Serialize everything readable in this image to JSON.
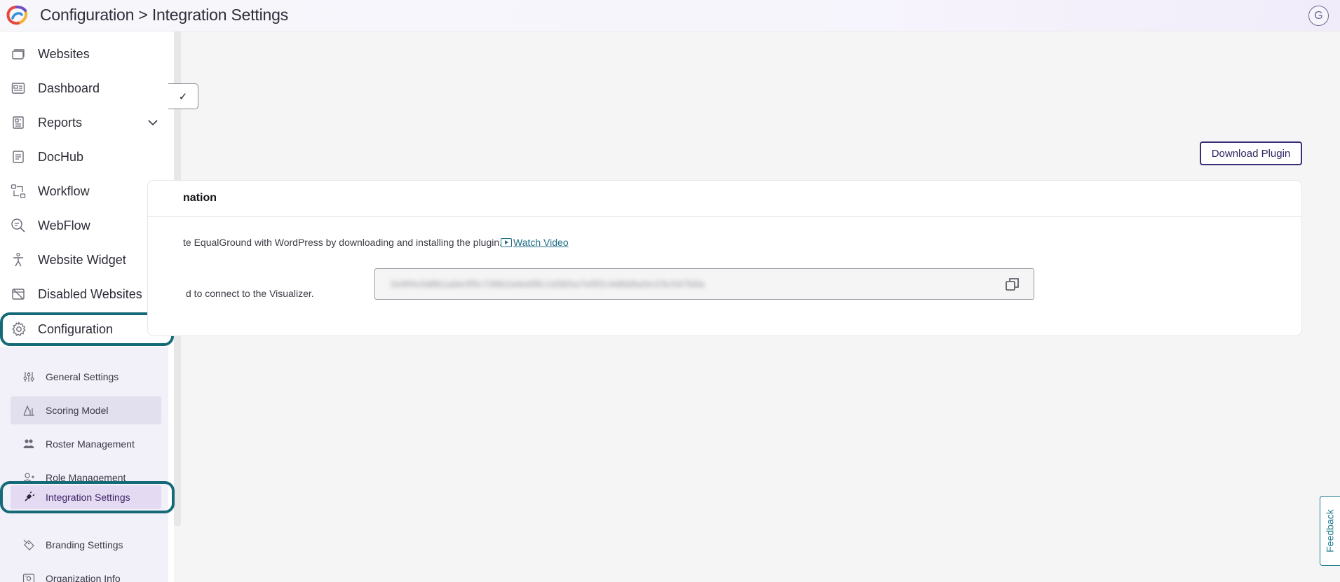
{
  "header": {
    "title": "Configuration > Integration Settings",
    "avatar_initial": "G"
  },
  "sidebar": {
    "items": [
      {
        "label": "Websites",
        "icon": "websites-icon"
      },
      {
        "label": "Dashboard",
        "icon": "dashboard-icon"
      },
      {
        "label": "Reports",
        "icon": "reports-icon"
      },
      {
        "label": "DocHub",
        "icon": "dochub-icon"
      },
      {
        "label": "Workflow",
        "icon": "workflow-icon"
      },
      {
        "label": "WebFlow",
        "icon": "webflow-icon"
      },
      {
        "label": "Website Widget",
        "icon": "widget-icon"
      },
      {
        "label": "Disabled Websites",
        "icon": "disabled-websites-icon"
      },
      {
        "label": "Configuration",
        "icon": "gear-icon"
      }
    ],
    "submenu": [
      {
        "label": "General Settings",
        "icon": "sliders-icon"
      },
      {
        "label": "Scoring Model",
        "icon": "scoring-icon"
      },
      {
        "label": "Roster Management",
        "icon": "roster-icon"
      },
      {
        "label": "Role Management",
        "icon": "role-icon"
      },
      {
        "label": "Integration Settings",
        "icon": "plug-icon"
      },
      {
        "label": "Branding Settings",
        "icon": "branding-icon"
      },
      {
        "label": "Organization Info",
        "icon": "organization-icon"
      }
    ]
  },
  "main": {
    "dropdown_check": "✓",
    "download_button": "Download Plugin",
    "card": {
      "title": "nation",
      "description": "te EqualGround with WordPress by downloading and installing the plugin.",
      "watch_video": "Watch Video",
      "key_hint": "d to connect to the Visualizer.",
      "key_value": "2e9f4c0d8b1a6e3f5c7d9b2a4e6f8c1d3b5a7e9f2c4d6b8a0e1f3c5d7b9a"
    }
  },
  "feedback_label": "Feedback",
  "colors": {
    "accent": "#156a78",
    "brand_purple": "#3a2d78",
    "active_bg": "#e4daf2",
    "submenu_bg": "#f2f0f8"
  }
}
